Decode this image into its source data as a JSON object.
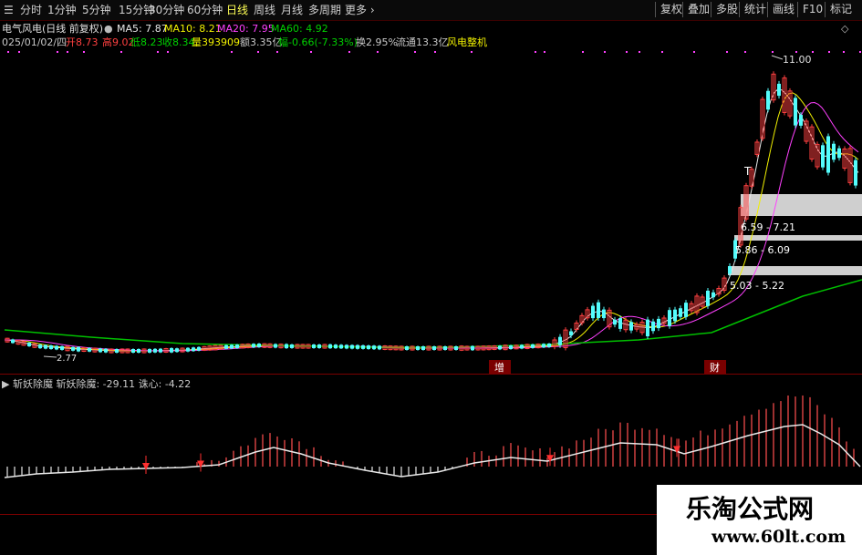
{
  "period_bar": {
    "menu_icon": "menu-icon",
    "items": [
      "分时",
      "1分钟",
      "5分钟",
      "15分钟",
      "30分钟",
      "60分钟",
      "日线",
      "周线",
      "月线",
      "多周期",
      "更多"
    ],
    "active": "日线",
    "tools": [
      "复权",
      "叠加",
      "多股",
      "统计",
      "画线",
      "F10",
      "标记"
    ]
  },
  "info": {
    "title": "电气风电(日线 前复权)",
    "ma5": "MA5: 7.87",
    "ma10": "MA10: 8.21",
    "ma20": "MA20: 7.95",
    "ma60": "MA60: 4.92",
    "date": "025/01/02/四",
    "open": "开8.73",
    "high": "高9.02",
    "low": "低8.23",
    "close": "收8.34",
    "volume": "量393909",
    "amount": "额3.35亿",
    "change": "幅-0.66(-7.33%)",
    "turnover": "换2.95%",
    "float": "流通13.3亿",
    "sector": "风电整机"
  },
  "price_panel": {
    "peak_label": "11.00",
    "low_label": "2.77",
    "zone_labels": [
      "6.59 - 7.21",
      "5.86 - 6.09",
      "5.03 - 5.22"
    ],
    "marker_zeng": "增",
    "marker_cai": "财",
    "marker_t": "T"
  },
  "indicator": {
    "name": "斩妖除魔",
    "value_label": "斩妖除魔: -29.11",
    "line_label": "诛心: -4.22"
  },
  "watermark": {
    "title": "乐淘公式网",
    "url": "www.60lt.com"
  },
  "colors": {
    "up": "#ff4040",
    "down": "#54fcfc",
    "ma5": "#e8e8e8",
    "ma10": "#f0f000",
    "ma20": "#ff40ff",
    "ma60": "#00c000",
    "active": "#ffff55"
  }
}
